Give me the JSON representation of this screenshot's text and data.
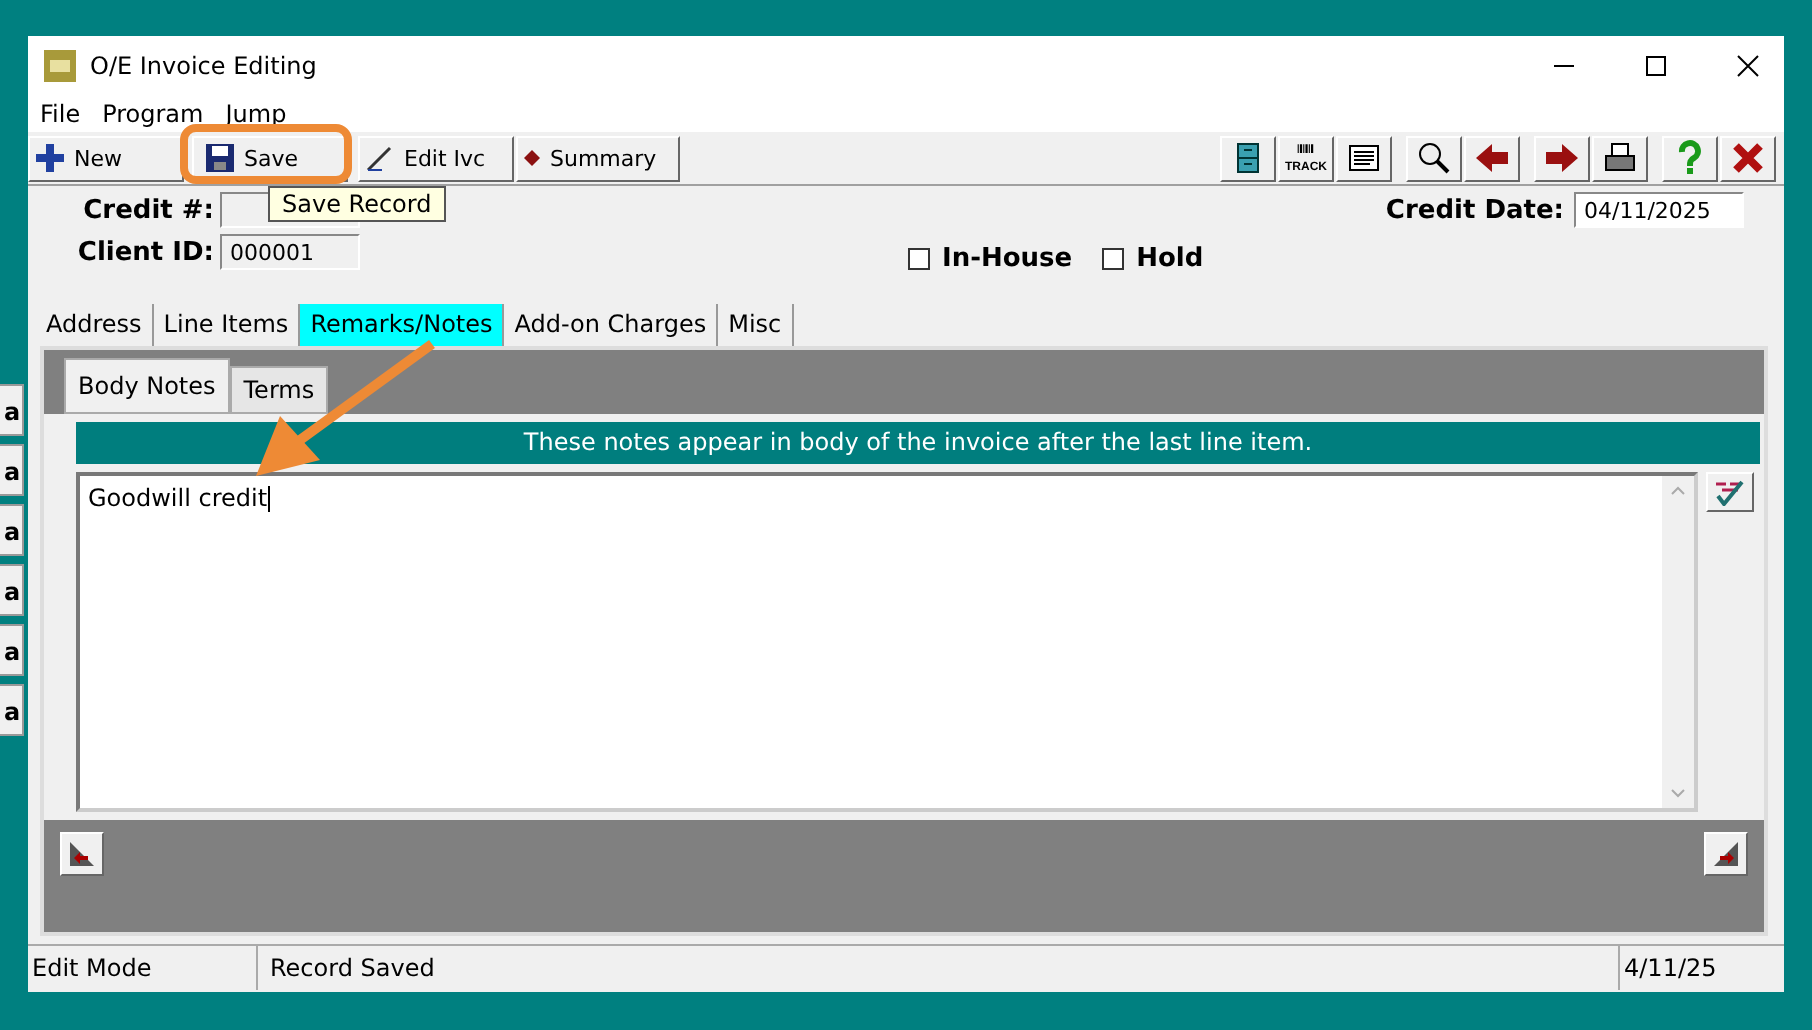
{
  "window": {
    "title": "O/E Invoice Editing"
  },
  "menu": [
    "File",
    "Program",
    "Jump"
  ],
  "toolbar": [
    {
      "label": "New",
      "kind": "new"
    },
    {
      "label": "Save",
      "kind": "save"
    },
    {
      "label": "Edit Ivc",
      "kind": "edit"
    },
    {
      "label": "Summary",
      "kind": "summary"
    }
  ],
  "toolbar_icons": [
    {
      "kind": "cabinet"
    },
    {
      "kind": "barcode",
      "label": "TRACK"
    },
    {
      "kind": "document"
    },
    {
      "kind": "magnifier"
    },
    {
      "kind": "arrow-left"
    },
    {
      "kind": "arrow-right"
    },
    {
      "kind": "printer"
    },
    {
      "kind": "help"
    },
    {
      "kind": "close"
    }
  ],
  "tooltip": "Save Record",
  "fields": {
    "credit_label": "Credit #:",
    "client_label": "Client ID:",
    "client_value": "000001",
    "date_label": "Credit Date:",
    "date_value": "04/11/2025"
  },
  "checkboxes": [
    {
      "label": "In-House",
      "checked": false
    },
    {
      "label": "Hold",
      "checked": false
    }
  ],
  "tabs": [
    {
      "label": "Address",
      "selected": false
    },
    {
      "label": "Line Items",
      "selected": false
    },
    {
      "label": "Remarks/Notes",
      "selected": true
    },
    {
      "label": "Add-on Charges",
      "selected": false
    },
    {
      "label": "Misc",
      "selected": false
    }
  ],
  "subtabs": [
    {
      "label": "Body Notes",
      "selected": true
    },
    {
      "label": "Terms",
      "selected": false
    }
  ],
  "banner": "These notes appear in body of the invoice after the last line item.",
  "notes": "Goodwill credit",
  "background_items": [
    "a",
    "a",
    "a",
    "a",
    "a",
    "a"
  ],
  "status_bar": [
    "Edit Mode",
    "Record Saved",
    "4/11/25"
  ]
}
